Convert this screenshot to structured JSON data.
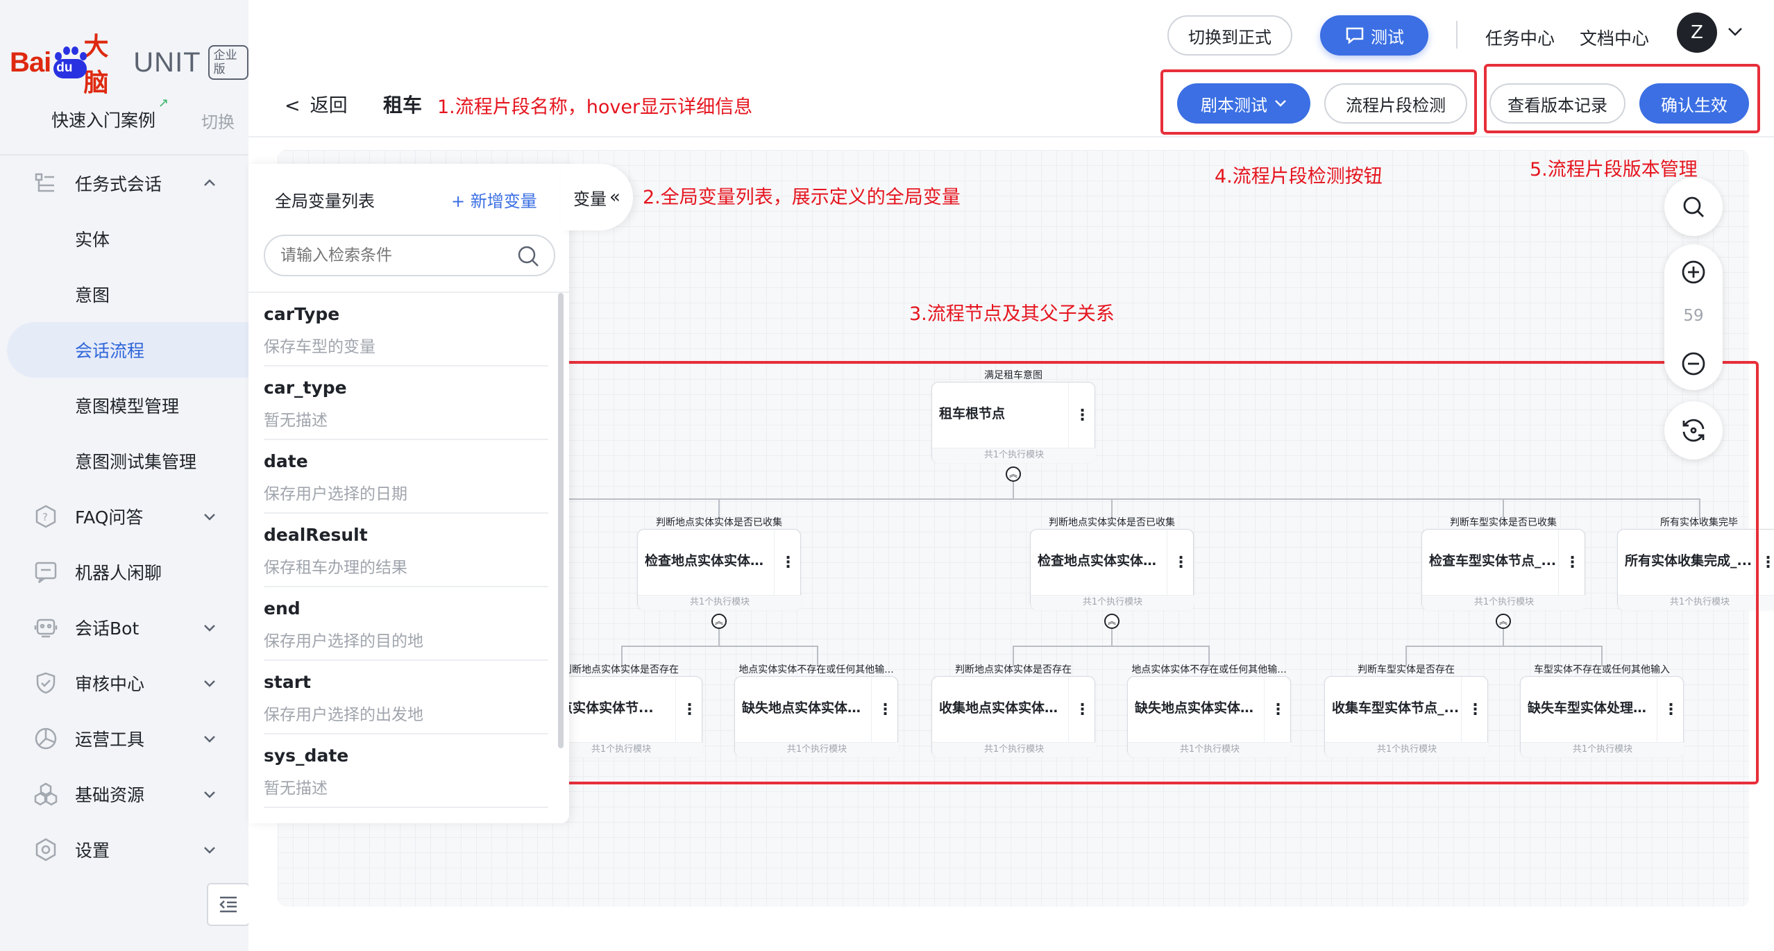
{
  "brand": {
    "bai": "Bai",
    "du": "du",
    "danao": "大脑",
    "unit": "UNIT",
    "edition": "企业版"
  },
  "sidebar": {
    "quick_start": "快速入门案例",
    "switch": "切换",
    "items": [
      {
        "label": "任务式会话",
        "icon": "task-dialog-icon",
        "expanded": true
      },
      {
        "label": "实体"
      },
      {
        "label": "意图"
      },
      {
        "label": "会话流程",
        "active": true
      },
      {
        "label": "意图模型管理"
      },
      {
        "label": "意图测试集管理"
      },
      {
        "label": "FAQ问答",
        "icon": "faq-icon"
      },
      {
        "label": "机器人闲聊",
        "icon": "chat-icon"
      },
      {
        "label": "会话Bot",
        "icon": "bot-icon"
      },
      {
        "label": "审核中心",
        "icon": "shield-check-icon"
      },
      {
        "label": "运营工具",
        "icon": "operation-tool-icon"
      },
      {
        "label": "基础资源",
        "icon": "resource-icon"
      },
      {
        "label": "设置",
        "icon": "settings-icon"
      }
    ]
  },
  "header": {
    "switch_formal": "切换到正式",
    "test": "测试",
    "task_center": "任务中心",
    "doc_center": "文档中心",
    "avatar": "Z"
  },
  "subheader": {
    "back": "返回",
    "title": "租车",
    "script_test": "剧本测试",
    "flow_check": "流程片段检测",
    "view_versions": "查看版本记录",
    "confirm": "确认生效"
  },
  "annotations": {
    "a1": "1.流程片段名称，hover显示详细信息",
    "a2": "2.全局变量列表，展示定义的全局变量",
    "a3": "3.流程节点及其父子关系",
    "a4": "4.流程片段检测按钮",
    "a5": "5.流程片段版本管理"
  },
  "var_panel": {
    "title": "全局变量列表",
    "add": "+ 新增变量",
    "tab_label": "变量",
    "search_placeholder": "请输入检索条件",
    "vars": [
      {
        "name": "carType",
        "desc": "保存车型的变量"
      },
      {
        "name": "car_type",
        "desc": "暂无描述"
      },
      {
        "name": "date",
        "desc": "保存用户选择的日期"
      },
      {
        "name": "dealResult",
        "desc": "保存租车办理的结果"
      },
      {
        "name": "end",
        "desc": "保存用户选择的目的地"
      },
      {
        "name": "start",
        "desc": "保存用户选择的出发地"
      },
      {
        "name": "sys_date",
        "desc": "暂无描述"
      }
    ]
  },
  "zoom": {
    "value": "59"
  },
  "flow": {
    "footer": "共1个执行模块",
    "root": {
      "cond": "满足租车意图",
      "name": "租车根节点"
    },
    "level1": [
      {
        "cond": "判断地点实体实体是否已收集",
        "name": "检查地点实体实体节..."
      },
      {
        "cond": "判断地点实体实体是否已收集",
        "name": "检查地点实体实体节..."
      },
      {
        "cond": "判断车型实体是否已收集",
        "name": "检查车型实体节点_..."
      },
      {
        "cond": "所有实体收集完毕",
        "name": "所有实体收集完成_..."
      }
    ],
    "level2": [
      {
        "cond": "判断地点实体实体是否存在",
        "name": "地点实体实体节..."
      },
      {
        "cond": "地点实体实体不存在或任何其他输...",
        "name": "缺失地点实体实体处..."
      },
      {
        "cond": "判断地点实体实体是否存在",
        "name": "收集地点实体实体节..."
      },
      {
        "cond": "地点实体实体不存在或任何其他输...",
        "name": "缺失地点实体实体处..."
      },
      {
        "cond": "判断车型实体是否存在",
        "name": "收集车型实体节点_..."
      },
      {
        "cond": "车型实体不存在或任何其他输入",
        "name": "缺失车型实体处理节..."
      }
    ]
  },
  "colors": {
    "primary": "#3b6fe3",
    "annotation": "#e5141e",
    "active_bg": "#e6ebf8"
  }
}
